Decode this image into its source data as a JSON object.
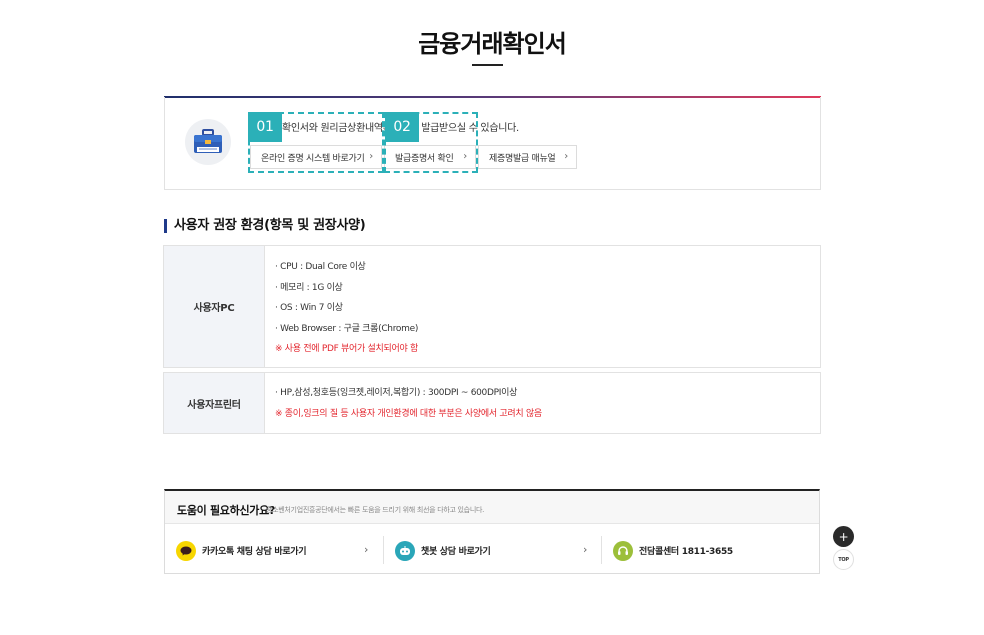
{
  "page": {
    "title": "금융거래확인서"
  },
  "info": {
    "text": "확인서와 원리금상환내역확인서를 발급받으실 수 있습니다.",
    "links": [
      {
        "label": "온라인 증명 시스템 바로가기"
      },
      {
        "label": "발급증명서 확인"
      },
      {
        "label": "제증명발급 매뉴얼"
      }
    ],
    "steps": [
      "01",
      "02"
    ],
    "icon": "briefcase-icon"
  },
  "section": {
    "title": "사용자 권장 환경(항목 및 권장사양)"
  },
  "specs": [
    {
      "label": "사용자PC",
      "items": [
        {
          "text": "· CPU : Dual Core 이상",
          "red": false
        },
        {
          "text": "· 메모리 : 1G 이상",
          "red": false
        },
        {
          "text": "· OS : Win 7 이상",
          "red": false
        },
        {
          "text": "· Web Browser : 구글 크롬(Chrome)",
          "red": false
        },
        {
          "text": "※ 사용 전에 PDF 뷰어가 설치되어야 함",
          "red": true
        }
      ]
    },
    {
      "label": "사용자프린터",
      "items": [
        {
          "text": "· HP,삼성,청호등(잉크젯,레이저,복합기) : 300DPI ~ 600DPI이상",
          "red": false
        },
        {
          "text": "※ 종이,잉크의 질 등 사용자 개인환경에 대한 부분은 사양에서 고려치 않음",
          "red": true
        }
      ]
    }
  ],
  "help": {
    "title": "도움이 필요하신가요?",
    "subtitle": "중소벤처기업진흥공단에서는 빠른 도움을 드리기 위해 최선을 다하고 있습니다.",
    "items": [
      {
        "label": "카카오톡 채팅 상담 바로가기",
        "icon": "kakaotalk-icon",
        "color": "#f7d600"
      },
      {
        "label": "챗봇 상담 바로가기",
        "icon": "chatbot-icon",
        "color": "#2aa6b8"
      },
      {
        "label": "전담콜센터 1811-3655",
        "icon": "headset-icon",
        "color": "#9cbf3a"
      }
    ]
  },
  "floating": {
    "plus": "+",
    "top": "TOP"
  },
  "colors": {
    "accent": "#2bb0b8",
    "navy": "#1f3a8a",
    "warning": "#e3262e"
  }
}
